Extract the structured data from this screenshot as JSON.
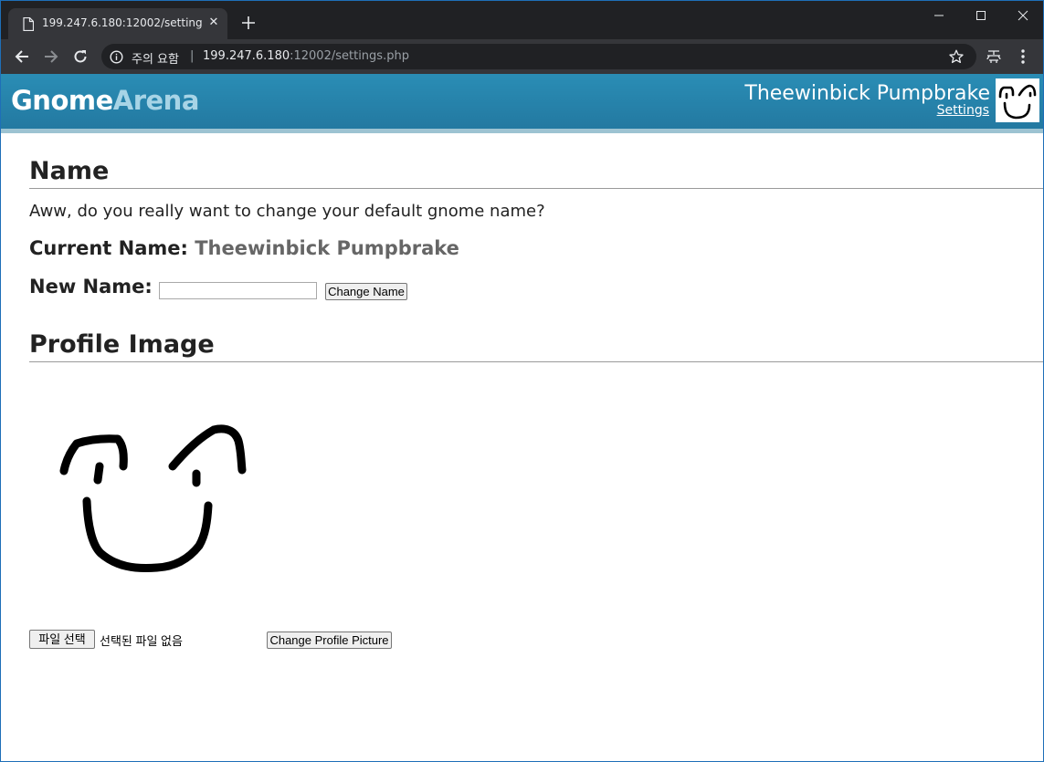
{
  "browser": {
    "tab_title": "199.247.6.180:12002/settings.php",
    "tab_close": "✕",
    "security_warning": "주의 요함",
    "url_host": "199.247.6.180",
    "url_rest": ":12002/settings.php"
  },
  "header": {
    "logo_part1": "Gnome",
    "logo_part2": "Arena",
    "user_name": "Theewinbick Pumpbrake",
    "settings_link": "Settings",
    "accent_color": "#2a8db5"
  },
  "name_section": {
    "heading": "Name",
    "prompt": "Aww, do you really want to change your default gnome name?",
    "current_label": "Current Name:",
    "current_value": "Theewinbick Pumpbrake",
    "new_label": "New Name:",
    "new_value": "",
    "change_button": "Change Name"
  },
  "profile_section": {
    "heading": "Profile Image",
    "choose_file_button": "파일 선택",
    "no_file_text": "선택된 파일 없음",
    "change_button": "Change Profile Picture"
  }
}
